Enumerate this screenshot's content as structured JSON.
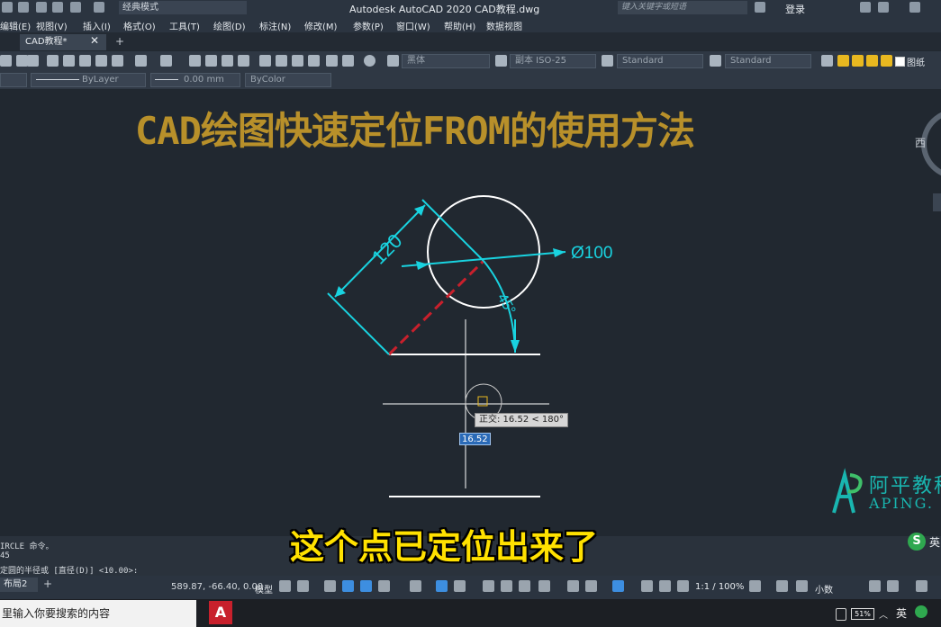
{
  "titlebar": {
    "app_title": "Autodesk AutoCAD 2020    CAD教程.dwg",
    "workspace": "经典模式",
    "search_placeholder": "键入关键字或短语",
    "login": "登录"
  },
  "menubar": {
    "items": [
      "编辑(E)",
      "视图(V)",
      "插入(I)",
      "格式(O)",
      "工具(T)",
      "绘图(D)",
      "标注(N)",
      "修改(M)",
      "参数(P)",
      "窗口(W)",
      "帮助(H)",
      "数据视图"
    ]
  },
  "tabs": {
    "active": "CAD教程*",
    "close": "✕",
    "add": "+"
  },
  "toolbar": {
    "text_style_font": "黑体",
    "dim_style": "副本 ISO-25",
    "table_style": "Standard",
    "multileader_style": "Standard",
    "layer_name": "图纸",
    "linetype": "ByLayer",
    "lineweight": "0.00 mm",
    "plot_style": "ByColor"
  },
  "drawing": {
    "title": "CAD绘图快速定位FROM的使用方法",
    "dim_linear": "120",
    "dim_diameter": "Ø100",
    "dim_angle": "45°",
    "tooltip": "正交: 16.52 < 180°",
    "dynamic_input": "16.52",
    "viewcube_label": "西"
  },
  "watermark": {
    "cn": "阿平教程",
    "en": "APING."
  },
  "command": {
    "history_1": "IRCLE 命令。",
    "history_2": "45",
    "prompt": "定圆的半径或 [直径(D)] <10.00>:"
  },
  "subtitle": "这个点已定位出来了",
  "ime": {
    "icon": "S",
    "lang": "英"
  },
  "statusbar": {
    "layout_tab": "布局2",
    "add_layout": "+",
    "coords": "589.87, -66.40, 0.00",
    "model": "模型",
    "scale": "1:1 / 100%",
    "units": "小数"
  },
  "taskbar": {
    "search_placeholder": "里输入你要搜索的内容",
    "acad_icon": "A",
    "battery": "51%",
    "lang": "英"
  },
  "colors": {
    "dimension": "#19d3e0",
    "geometry": "#ffffff",
    "construction": "#c8202c",
    "title": "#b8902a",
    "subtitle": "#ffe100"
  }
}
